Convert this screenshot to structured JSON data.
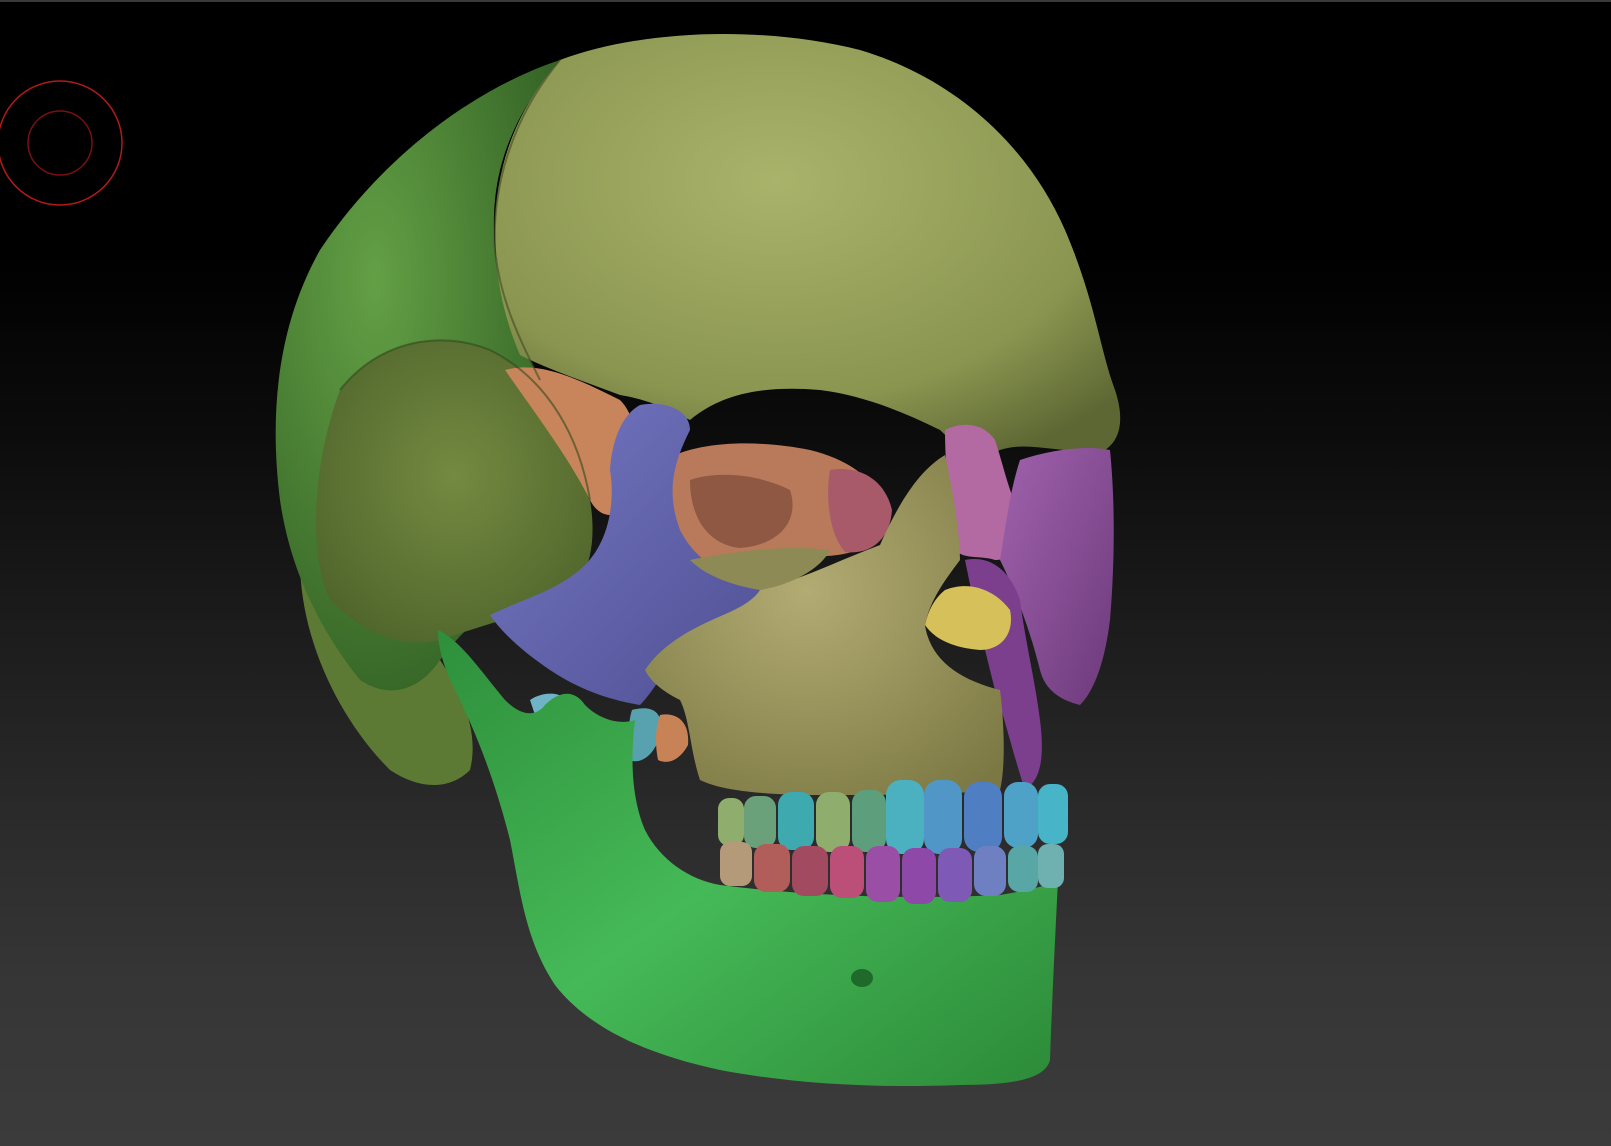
{
  "viewport": {
    "background_top": "#000000",
    "background_bottom": "#3b3b3b",
    "edge_color": "#3a3a3a"
  },
  "brush_cursor": {
    "icon": "brush-cursor-icon",
    "color": "#b01a1a"
  },
  "model": {
    "subject": "skull",
    "colors": {
      "parietal": "#4f8a37",
      "frontal": "#98a35a",
      "temporal": "#6a7f3a",
      "zygomatic": "#6466b0",
      "maxilla": "#a9a46a",
      "mandible": "#3fae4f",
      "sphenoid": "#d08a5c",
      "nasal": "#8d4d99",
      "lacrimal": "#b26aa0",
      "ethmoid": "#d7c25a",
      "teeth_upper": [
        "#6aa07a",
        "#5d9f7c",
        "#3fa9b0",
        "#8fae6e",
        "#4bb0c0",
        "#5096c6",
        "#4fa2c7",
        "#47b4c8"
      ],
      "teeth_lower": [
        "#b59a7a",
        "#b15e5a",
        "#a24a60",
        "#bb4f77",
        "#9b4ea6",
        "#7e59b6",
        "#6f80c2",
        "#58a6a6"
      ]
    }
  }
}
